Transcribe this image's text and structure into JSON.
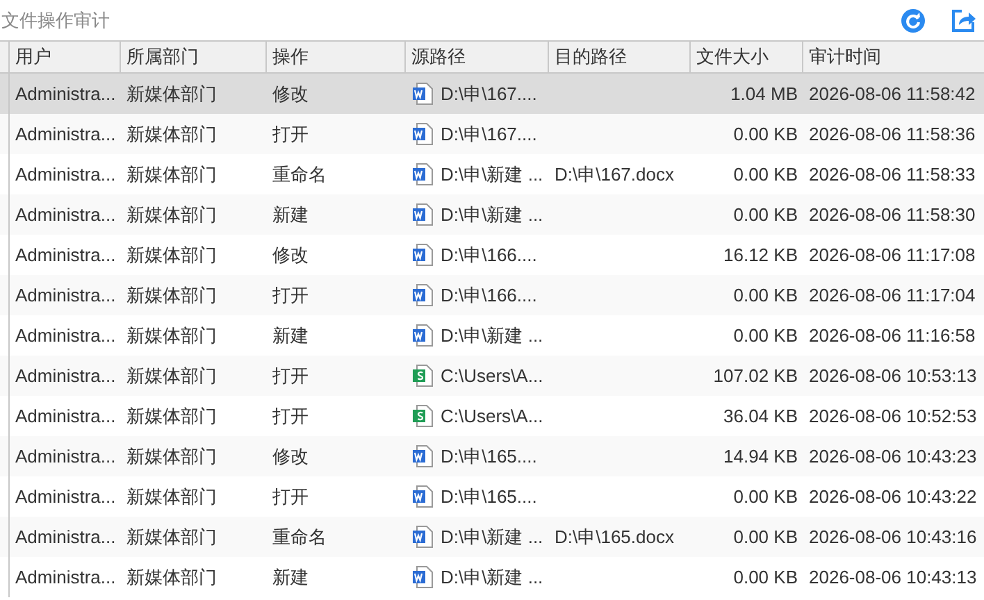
{
  "title": "文件操作审计",
  "table": {
    "columns": [
      "用户",
      "所属部门",
      "操作",
      "源路径",
      "目的路径",
      "文件大小",
      "审计时间"
    ],
    "rows": [
      {
        "selected": true,
        "user": "Administra...",
        "dept": "新媒体部门",
        "op": "修改",
        "kind": "word",
        "src": "D:\\申\\167....",
        "dst": "",
        "size": "1.04 MB",
        "time": "2026-08-06 11:58:42"
      },
      {
        "selected": false,
        "user": "Administra...",
        "dept": "新媒体部门",
        "op": "打开",
        "kind": "word",
        "src": "D:\\申\\167....",
        "dst": "",
        "size": "0.00 KB",
        "time": "2026-08-06 11:58:36"
      },
      {
        "selected": false,
        "user": "Administra...",
        "dept": "新媒体部门",
        "op": "重命名",
        "kind": "word",
        "src": "D:\\申\\新建 ...",
        "dst": "D:\\申\\167.docx",
        "size": "0.00 KB",
        "time": "2026-08-06 11:58:33"
      },
      {
        "selected": false,
        "user": "Administra...",
        "dept": "新媒体部门",
        "op": "新建",
        "kind": "word",
        "src": "D:\\申\\新建 ...",
        "dst": "",
        "size": "0.00 KB",
        "time": "2026-08-06 11:58:30"
      },
      {
        "selected": false,
        "user": "Administra...",
        "dept": "新媒体部门",
        "op": "修改",
        "kind": "word",
        "src": "D:\\申\\166....",
        "dst": "",
        "size": "16.12 KB",
        "time": "2026-08-06 11:17:08"
      },
      {
        "selected": false,
        "user": "Administra...",
        "dept": "新媒体部门",
        "op": "打开",
        "kind": "word",
        "src": "D:\\申\\166....",
        "dst": "",
        "size": "0.00 KB",
        "time": "2026-08-06 11:17:04"
      },
      {
        "selected": false,
        "user": "Administra...",
        "dept": "新媒体部门",
        "op": "新建",
        "kind": "word",
        "src": "D:\\申\\新建 ...",
        "dst": "",
        "size": "0.00 KB",
        "time": "2026-08-06 11:16:58"
      },
      {
        "selected": false,
        "user": "Administra...",
        "dept": "新媒体部门",
        "op": "打开",
        "kind": "sheet",
        "src": "C:\\Users\\A...",
        "dst": "",
        "size": "107.02 KB",
        "time": "2026-08-06 10:53:13"
      },
      {
        "selected": false,
        "user": "Administra...",
        "dept": "新媒体部门",
        "op": "打开",
        "kind": "sheet",
        "src": "C:\\Users\\A...",
        "dst": "",
        "size": "36.04 KB",
        "time": "2026-08-06 10:52:53"
      },
      {
        "selected": false,
        "user": "Administra...",
        "dept": "新媒体部门",
        "op": "修改",
        "kind": "word",
        "src": "D:\\申\\165....",
        "dst": "",
        "size": "14.94 KB",
        "time": "2026-08-06 10:43:23"
      },
      {
        "selected": false,
        "user": "Administra...",
        "dept": "新媒体部门",
        "op": "打开",
        "kind": "word",
        "src": "D:\\申\\165....",
        "dst": "",
        "size": "0.00 KB",
        "time": "2026-08-06 10:43:22"
      },
      {
        "selected": false,
        "user": "Administra...",
        "dept": "新媒体部门",
        "op": "重命名",
        "kind": "word",
        "src": "D:\\申\\新建 ...",
        "dst": "D:\\申\\165.docx",
        "size": "0.00 KB",
        "time": "2026-08-06 10:43:16"
      },
      {
        "selected": false,
        "user": "Administra...",
        "dept": "新媒体部门",
        "op": "新建",
        "kind": "word",
        "src": "D:\\申\\新建 ...",
        "dst": "",
        "size": "0.00 KB",
        "time": "2026-08-06 10:43:13"
      }
    ]
  }
}
